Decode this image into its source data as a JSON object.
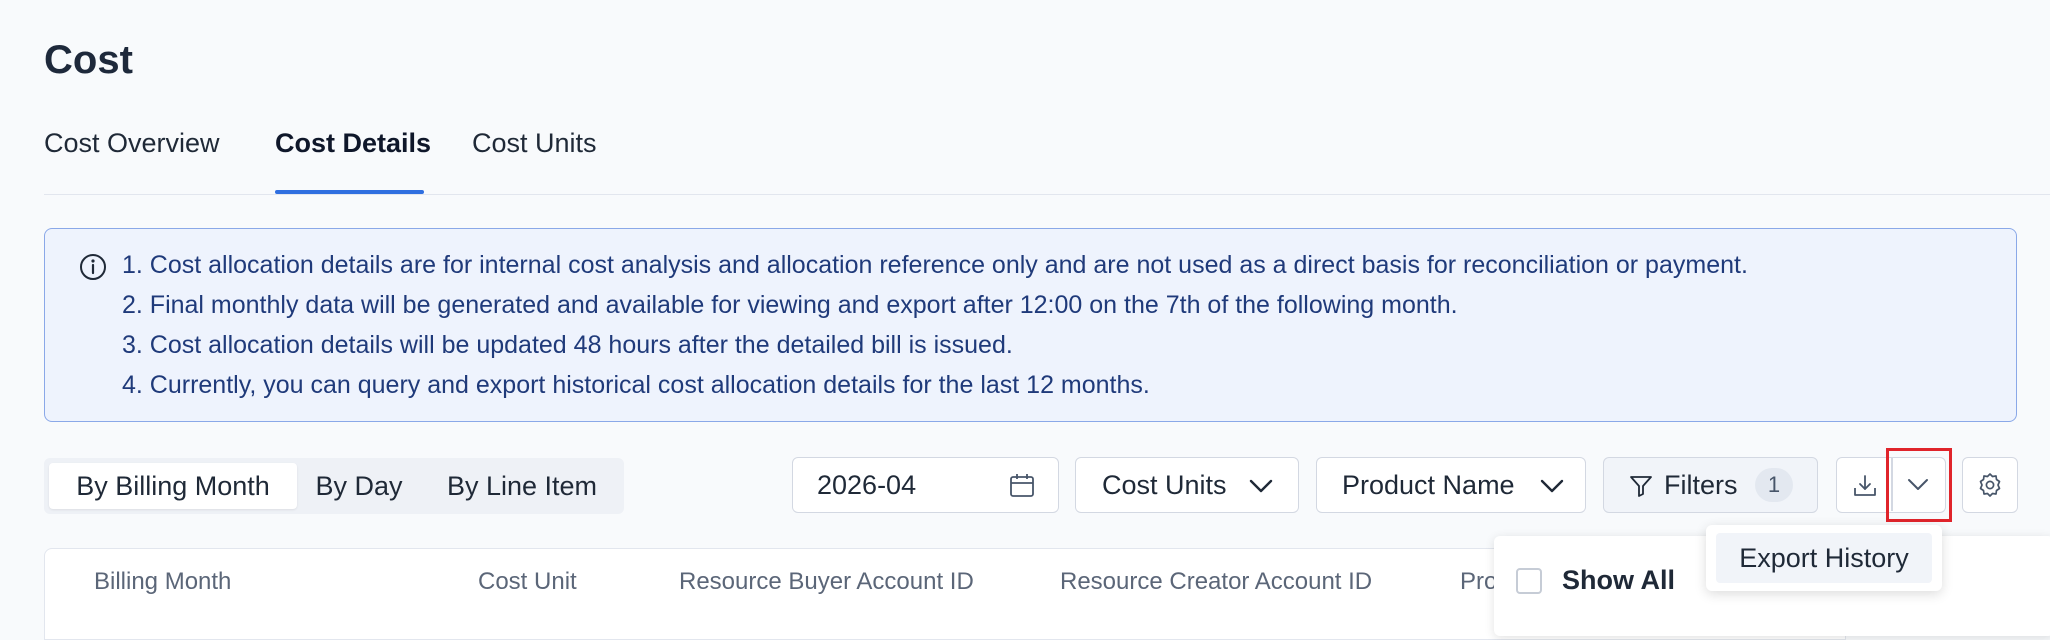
{
  "page": {
    "title": "Cost"
  },
  "tabs": [
    {
      "label": "Cost Overview"
    },
    {
      "label": "Cost Details"
    },
    {
      "label": "Cost Units"
    }
  ],
  "notice": {
    "lines": [
      "1. Cost allocation details are for internal cost analysis and allocation reference only and are not used as a direct basis for reconciliation or payment.",
      "2. Final monthly data will be generated and available for viewing and export after 12:00 on the 7th of the following month.",
      "3. Cost allocation details will be updated 48 hours after the detailed bill is issued.",
      "4. Currently, you can query and export historical cost allocation details for the last 12 months."
    ]
  },
  "granularity": {
    "options": [
      "By Billing Month",
      "By Day",
      "By Line Item"
    ],
    "selected": "By Billing Month"
  },
  "toolbar": {
    "month_value": "2026-04",
    "cost_units_label": "Cost Units",
    "product_name_label": "Product Name",
    "filters_label": "Filters",
    "filters_count": "1"
  },
  "table": {
    "columns": [
      "Billing Month",
      "Cost Unit",
      "Resource Buyer Account ID",
      "Resource Creator Account ID",
      "Pro"
    ]
  },
  "column_settings": {
    "show_all_label": "Show All"
  },
  "export_menu": {
    "items": [
      "Export History"
    ]
  },
  "colors": {
    "accent": "#2f6fe0",
    "notice_bg": "#eef3fd",
    "notice_border": "#8aa8e8",
    "highlight": "#e0242b"
  }
}
